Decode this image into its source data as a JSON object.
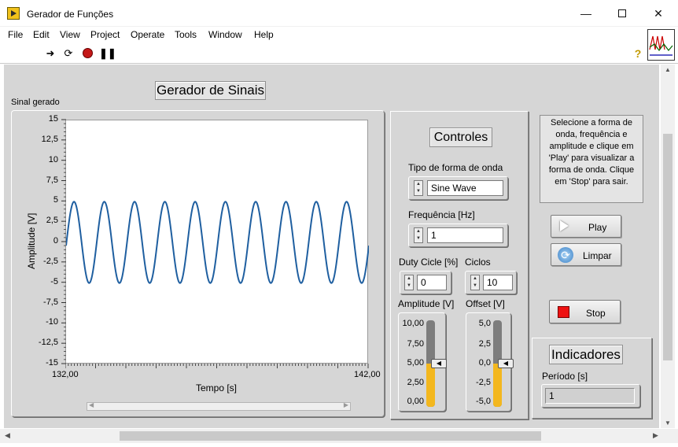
{
  "window": {
    "title": "Gerador de Funções",
    "minimize_icon": "minimize-icon",
    "maximize_icon": "maximize-icon",
    "close_icon": "close-icon"
  },
  "menu": [
    "File",
    "Edit",
    "View",
    "Project",
    "Operate",
    "Tools",
    "Window",
    "Help"
  ],
  "toolbar": {
    "run": "run-arrow-icon",
    "run_continuous": "run-continuously-icon",
    "abort": "abort-icon",
    "pause": "pause-icon",
    "help": "?"
  },
  "panel": {
    "main_title": "Gerador de Sinais",
    "graph_label": "Sinal gerado",
    "controls_title": "Controles",
    "waveform_label": "Tipo de forma de onda",
    "waveform_value": "Sine Wave",
    "freq_label": "Frequência [Hz]",
    "freq_value": "1",
    "duty_label": "Duty Cicle [%]",
    "duty_value": "0",
    "cycles_label": "Ciclos",
    "cycles_value": "10",
    "amp_label": "Amplitude [V]",
    "offset_label": "Offset [V]",
    "amp_ticks": [
      "10,00",
      "7,50",
      "5,00",
      "2,50",
      "0,00"
    ],
    "offset_ticks": [
      "5,0",
      "2,5",
      "0,0",
      "-2,5",
      "-5,0"
    ],
    "amp_value": 5,
    "amp_range": [
      0,
      10
    ],
    "offset_value": 0,
    "offset_range": [
      -5,
      5
    ],
    "instructions": "Selecione a forma de onda, frequência e amplitude e clique em 'Play' para visualizar a forma de onda. Clique em 'Stop' para sair.",
    "play_label": "Play",
    "clear_label": "Limpar",
    "stop_label": "Stop",
    "indicators_title": "Indicadores",
    "period_label": "Período [s]",
    "period_value": "1",
    "stop_color": "#ee1111",
    "trace_color": "#1f5fa0"
  },
  "chart_data": {
    "type": "line",
    "title": "",
    "xlabel": "Tempo [s]",
    "ylabel": "Amplitude [V]",
    "xlim": [
      132,
      142
    ],
    "ylim": [
      -15,
      15
    ],
    "x_tick_labels": [
      "132,00",
      "142,00"
    ],
    "y_tick_labels": [
      "15",
      "12,5",
      "10",
      "7,5",
      "5",
      "2,5",
      "0",
      "-2,5",
      "-5",
      "-7,5",
      "-10",
      "-12,5",
      "-15"
    ],
    "series": [
      {
        "amplitude": 5,
        "offset": 0,
        "frequency_hz": 1,
        "x_start": 132,
        "x_end": 142
      }
    ],
    "grid": false
  }
}
